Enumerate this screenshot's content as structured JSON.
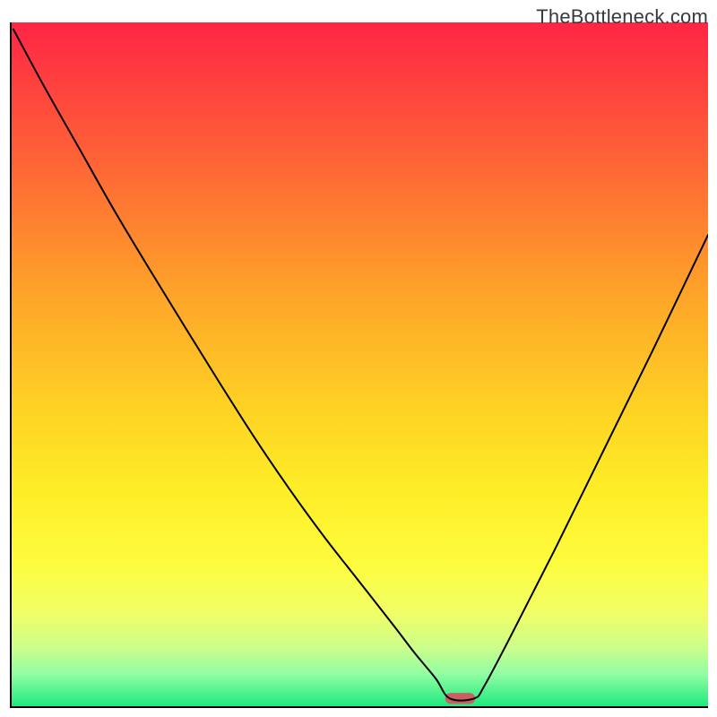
{
  "watermark": "TheBottleneck.com",
  "chart_data": {
    "type": "line",
    "title": "",
    "xlabel": "",
    "ylabel": "",
    "xlim": [
      0,
      100
    ],
    "ylim": [
      0,
      100
    ],
    "grid": false,
    "curve_note": "V-shaped bottleneck curve over a vertical red→green gradient background (green at bottom). Minimum at x≈64 with a short flat segment, left branch convex, right branch nearly linear.",
    "x": [
      0.5,
      5,
      10,
      15,
      20,
      25,
      30,
      35,
      40,
      45,
      50,
      55,
      58,
      61,
      63,
      66.5,
      68,
      72,
      78,
      85,
      92,
      100
    ],
    "values": [
      99,
      90.5,
      81.5,
      72.5,
      64,
      55.7,
      47.5,
      39.5,
      32,
      25,
      18.5,
      12,
      8,
      4.3,
      1.4,
      1.4,
      3.3,
      11,
      23,
      37.5,
      52,
      69
    ],
    "marker": {
      "x_center": 64.5,
      "y": 1.4,
      "width": 4.3,
      "height": 1.6,
      "fill": "#cc5f66"
    },
    "background_gradient_stops": [
      {
        "offset": 0,
        "color": "#fe2545"
      },
      {
        "offset": 20,
        "color": "#fe6336"
      },
      {
        "offset": 40,
        "color": "#fea529"
      },
      {
        "offset": 55,
        "color": "#fecf24"
      },
      {
        "offset": 68,
        "color": "#feed26"
      },
      {
        "offset": 79,
        "color": "#fdfc3e"
      },
      {
        "offset": 86,
        "color": "#f1fe66"
      },
      {
        "offset": 91,
        "color": "#cefe89"
      },
      {
        "offset": 95,
        "color": "#92fea4"
      },
      {
        "offset": 100,
        "color": "#17e87c"
      }
    ],
    "axis_stroke": "#000000",
    "line_stroke": "#000000",
    "line_width": 2
  }
}
